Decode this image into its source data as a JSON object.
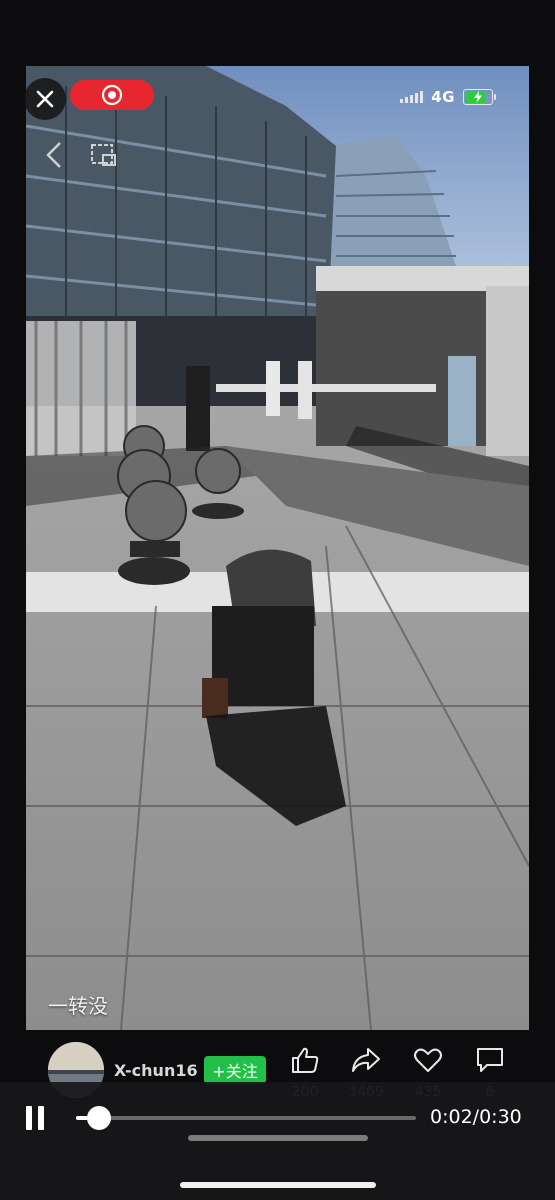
{
  "overlay": {
    "close_icon": "close-icon",
    "record_icon": "record-icon",
    "network": "4G",
    "battery_charging": true,
    "accent_red": "#e8262f"
  },
  "video": {
    "caption": "一转没",
    "scene": "street sidewalk with modern building, stone bollards and a person"
  },
  "author": {
    "username": "X-chun16",
    "follow_label": "+关注",
    "follow_color": "#22c049"
  },
  "actions": [
    {
      "icon": "thumbs-up-icon",
      "count": "200"
    },
    {
      "icon": "share-icon",
      "count": "3469"
    },
    {
      "icon": "heart-icon",
      "count": "435"
    },
    {
      "icon": "comment-icon",
      "count": "6"
    }
  ],
  "player": {
    "current": "0:02",
    "separator": "/",
    "duration": "0:30",
    "progress_fraction": 0.067
  }
}
